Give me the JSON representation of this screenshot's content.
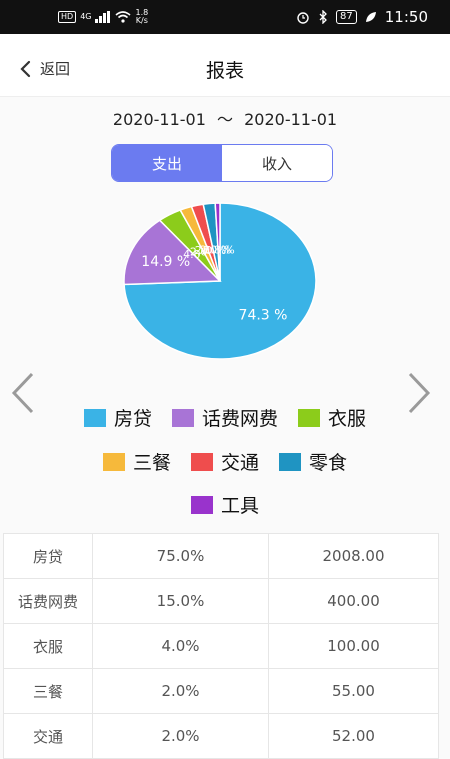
{
  "status_bar": {
    "network": "HD",
    "signal": "4G",
    "speed_value": "1.8",
    "speed_unit": "K/s",
    "battery": "87",
    "time": "11:50"
  },
  "header": {
    "back_label": "返回",
    "title": "报表"
  },
  "date_range": {
    "start": "2020-11-01",
    "separator": "～",
    "end": "2020-11-01"
  },
  "segment": {
    "tabs": [
      {
        "label": "支出",
        "active": true
      },
      {
        "label": "收入",
        "active": false
      }
    ]
  },
  "chart_data": {
    "type": "pie",
    "slices": [
      {
        "label": "房贷",
        "value": 74.3,
        "color": "#3ab3e6",
        "text": "74.3 %"
      },
      {
        "label": "话费网费",
        "value": 14.9,
        "color": "#a874d6",
        "text": "14.9 %"
      },
      {
        "label": "衣服",
        "value": 4.0,
        "color": "#8ccc1b",
        "text": "4.0 %"
      },
      {
        "label": "三餐",
        "value": 2.0,
        "color": "#f6b93b",
        "text": "2.0 %"
      },
      {
        "label": "交通",
        "value": 2.0,
        "color": "#ef4d4d",
        "text": "2.0 %"
      },
      {
        "label": "零食",
        "value": 2.0,
        "color": "#1f94c2",
        "text": "2.0 %"
      },
      {
        "label": "工具",
        "value": 0.8,
        "color": "#9933cc",
        "text": "0.8 %"
      }
    ]
  },
  "legend": {
    "rows": [
      [
        {
          "label": "房贷",
          "color": "#3ab3e6"
        },
        {
          "label": "话费网费",
          "color": "#a874d6"
        },
        {
          "label": "衣服",
          "color": "#8ccc1b"
        }
      ],
      [
        {
          "label": "三餐",
          "color": "#f6b93b"
        },
        {
          "label": "交通",
          "color": "#ef4d4d"
        },
        {
          "label": "零食",
          "color": "#1f94c2"
        }
      ],
      [
        {
          "label": "工具",
          "color": "#9933cc"
        }
      ]
    ]
  },
  "table": {
    "rows": [
      [
        "房贷",
        "75.0%",
        "2008.00"
      ],
      [
        "话费网费",
        "15.0%",
        "400.00"
      ],
      [
        "衣服",
        "4.0%",
        "100.00"
      ],
      [
        "三餐",
        "2.0%",
        "55.00"
      ],
      [
        "交通",
        "2.0%",
        "52.00"
      ]
    ]
  }
}
